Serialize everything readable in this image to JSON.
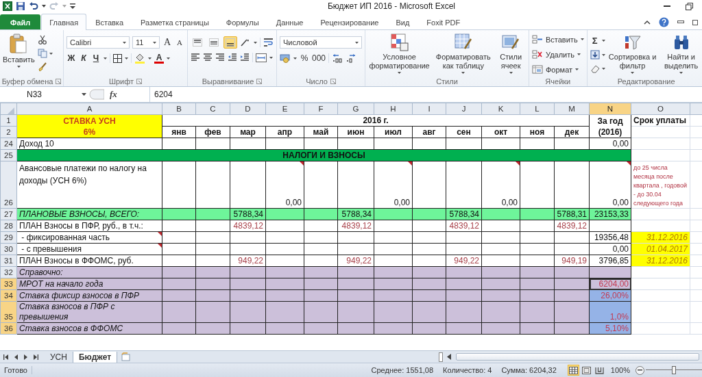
{
  "title_bar": {
    "title": "Бюджет ИП 2016 - Microsoft Excel"
  },
  "ribbon_tabs": [
    {
      "label": "Файл",
      "kind": "file",
      "selected": false
    },
    {
      "label": "Главная",
      "kind": "tab",
      "selected": true
    },
    {
      "label": "Вставка",
      "kind": "tab",
      "selected": false
    },
    {
      "label": "Разметка страницы",
      "kind": "tab",
      "selected": false
    },
    {
      "label": "Формулы",
      "kind": "tab",
      "selected": false
    },
    {
      "label": "Данные",
      "kind": "tab",
      "selected": false
    },
    {
      "label": "Рецензирование",
      "kind": "tab",
      "selected": false
    },
    {
      "label": "Вид",
      "kind": "tab",
      "selected": false
    },
    {
      "label": "Foxit PDF",
      "kind": "tab",
      "selected": false
    }
  ],
  "ribbon": {
    "clipboard": {
      "paste": "Вставить",
      "label": "Буфер обмена"
    },
    "font": {
      "name": "Calibri",
      "size": "11",
      "grow": "A",
      "shrink": "A",
      "bold": "Ж",
      "italic": "К",
      "underline": "Ч",
      "color_letter": "А",
      "label": "Шрифт"
    },
    "alignment": {
      "label": "Выравнивание",
      "vertical": [
        {
          "selected": false
        },
        {
          "selected": false
        },
        {
          "selected": true
        }
      ]
    },
    "number": {
      "format": "Числовой",
      "percent": "%",
      "thousands": "000",
      "label": "Число"
    },
    "styles": {
      "conditional": "Условное форматирование",
      "as_table": "Форматировать как таблицу",
      "cell_styles": "Стили ячеек",
      "label": "Стили"
    },
    "cells": {
      "insert": "Вставить",
      "delete": "Удалить",
      "format": "Формат",
      "label": "Ячейки"
    },
    "editing": {
      "sum": "Σ",
      "sort": "Сортировка и фильтр",
      "find": "Найти и выделить",
      "label": "Редактирование"
    }
  },
  "formula_bar": {
    "name_box": "N33",
    "fx": "fx",
    "value": "6204"
  },
  "sheet": {
    "columns": [
      {
        "label": "A",
        "selected": false
      },
      {
        "label": "B",
        "selected": false
      },
      {
        "label": "C",
        "selected": false
      },
      {
        "label": "D",
        "selected": false
      },
      {
        "label": "E",
        "selected": false
      },
      {
        "label": "F",
        "selected": false
      },
      {
        "label": "G",
        "selected": false
      },
      {
        "label": "H",
        "selected": false
      },
      {
        "label": "I",
        "selected": false
      },
      {
        "label": "J",
        "selected": false
      },
      {
        "label": "K",
        "selected": false
      },
      {
        "label": "L",
        "selected": false
      },
      {
        "label": "M",
        "selected": false
      },
      {
        "label": "N",
        "selected": true
      },
      {
        "label": "O",
        "selected": false
      }
    ],
    "header": {
      "row_numbers": [
        "1",
        "2"
      ],
      "rate_label": "СТАВКА УСН",
      "rate_value": "6%",
      "year": "2016 г.",
      "months": [
        "янв",
        "фев",
        "мар",
        "апр",
        "май",
        "июн",
        "июл",
        "авг",
        "сен",
        "окт",
        "ноя",
        "дек"
      ],
      "total_line_1": "За год",
      "total_line_2": "(2016)",
      "due_label": "Срок уплаты"
    },
    "rows": [
      {
        "number": "24",
        "selected": false,
        "kind": "plain",
        "label": "Доход 10",
        "total": "0,00"
      },
      {
        "number": "25",
        "selected": false,
        "kind": "section",
        "title": "НАЛОГИ И ВЗНОСЫ"
      },
      {
        "number": "26",
        "selected": false,
        "kind": "tall",
        "label": "Авансовые платежи по налогу на доходы (УСН 6%)",
        "values": {
          "E": {
            "text": "0,00",
            "comment": true
          },
          "H": {
            "text": "0,00",
            "comment": true
          },
          "K": {
            "text": "0,00",
            "comment": true
          }
        },
        "total": "0,00",
        "total_comment": true,
        "due": {
          "kind": "note",
          "text": "до 25 числа месяца после квартала , годовой - до 30.04 следующего года"
        }
      },
      {
        "number": "27",
        "selected": false,
        "kind": "total",
        "label": "ПЛАНОВЫЕ ВЗНОСЫ, ВСЕГО:",
        "values": {
          "D": {
            "text": "5788,34"
          },
          "G": {
            "text": "5788,34"
          },
          "J": {
            "text": "5788,34"
          },
          "M": {
            "text": "5788,31"
          }
        },
        "total": "23153,33"
      },
      {
        "number": "28",
        "selected": false,
        "kind": "plan",
        "label": "ПЛАН Взносы в ПФР, руб., в т.ч.:",
        "values": {
          "D": {
            "text": "4839,12"
          },
          "G": {
            "text": "4839,12"
          },
          "J": {
            "text": "4839,12"
          },
          "M": {
            "text": "4839,12"
          }
        }
      },
      {
        "number": "29",
        "selected": false,
        "kind": "plain",
        "label": " - фиксированная часть",
        "label_comment": true,
        "total": "19356,48",
        "due": {
          "kind": "date",
          "text": "31.12.2016"
        }
      },
      {
        "number": "30",
        "selected": false,
        "kind": "plain",
        "label": " - с превышения",
        "label_comment": true,
        "total": "0,00",
        "due": {
          "kind": "date",
          "text": "01.04.2017"
        }
      },
      {
        "number": "31",
        "selected": false,
        "kind": "plan",
        "label": "ПЛАН Взносы в ФФОМС, руб.",
        "values": {
          "D": {
            "text": "949,22"
          },
          "G": {
            "text": "949,22"
          },
          "J": {
            "text": "949,22"
          },
          "M": {
            "text": "949,19"
          }
        },
        "total": "3796,85",
        "due": {
          "kind": "date",
          "text": "31.12.2016"
        }
      },
      {
        "number": "32",
        "selected": false,
        "kind": "reference",
        "label": "Справочно:"
      },
      {
        "number": "33",
        "selected": true,
        "active": true,
        "kind": "reference",
        "label": "МРОТ на начало года",
        "total": "6204,00"
      },
      {
        "number": "34",
        "selected": true,
        "active": false,
        "kind": "reference",
        "label": "Ставка фиксир взносов в ПФР",
        "total": "26,00%"
      },
      {
        "number": "35",
        "selected": true,
        "active": false,
        "kind": "reference",
        "label": "Ставка взносов в ПФР с превышения",
        "total": "1,0%"
      },
      {
        "number": "36",
        "selected": true,
        "active": false,
        "kind": "reference",
        "label": "Ставка взносов в ФФОМС",
        "total": "5,10%"
      }
    ]
  },
  "sheet_tabs": [
    {
      "label": "УСН",
      "selected": false
    },
    {
      "label": "Бюджет",
      "selected": true
    }
  ],
  "status_bar": {
    "ready": "Готово",
    "average": "Среднее: 1551,08",
    "count": "Количество: 4",
    "sum": "Сумма: 6204,32",
    "views": [
      {
        "selected": true
      },
      {
        "selected": false
      },
      {
        "selected": false
      }
    ],
    "zoom": "100%",
    "zoom_slider": {
      "level": 0.5
    }
  }
}
